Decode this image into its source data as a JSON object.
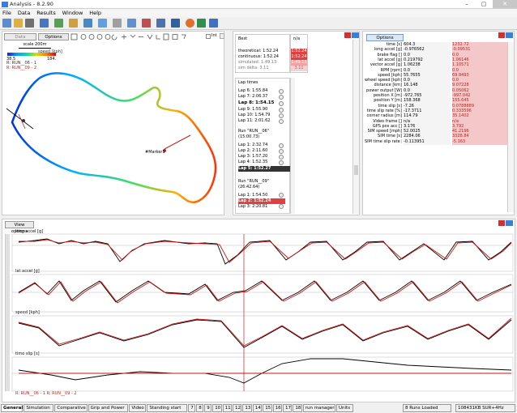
{
  "window": {
    "title": "Analysis - 8.2.90"
  },
  "menu": [
    "File",
    "Data",
    "Results",
    "Window",
    "Help"
  ],
  "map": {
    "tab_data": "Data",
    "tab_options": "Options",
    "scale": "scale 200m",
    "speed_label": "speed [kph]",
    "speed_min": "38.5",
    "speed_max": "184.",
    "run1": "R: RUN__06 - 1",
    "run2": "R: RUN__09 - 2",
    "marker": "#Marker1",
    "lap_short": "Int"
  },
  "best": {
    "header": "Best",
    "col2": "n/a",
    "rows": [
      [
        "theoretical: 1:52.24",
        "1:52.24"
      ],
      [
        "continuous: 1:52.24",
        "1:52.24"
      ],
      [
        "simulated: 1:49.13",
        "1:49.13"
      ],
      [
        "sim delta: 3.11",
        "3.11"
      ]
    ]
  },
  "laps": {
    "header": "Lap times",
    "items": [
      "Lap 6: 1:55.84",
      "Lap 7: 2:06.37",
      "Lap 8: 1:54.15",
      "Lap 9: 1:55.90",
      "Lap 10: 1:54.79",
      "Lap 11: 2:01.62",
      "",
      "Run \"RUN__06\"",
      "(15:00.73)",
      "Lap 1: 2:32.74",
      "Lap 2: 2:11.60",
      "Lap 3: 1:57.20",
      "Lap 4: 1:52.35",
      "Lap 5: 1:52.27",
      "",
      "Run \"RUN__09\"",
      "(26:42.64)",
      "Lap 1: 1:54.50",
      "Lap 2: 1:52.24",
      "Lap 3: 2:20.81"
    ]
  },
  "channels": {
    "options": "Options",
    "rows": [
      [
        "time [s]",
        "604.3",
        "1232.72"
      ],
      [
        "long accel [g]",
        "-0.976562",
        "-0.09531"
      ],
      [
        "brake flag []",
        "0.0",
        "0.0"
      ],
      [
        "lat accel [g]",
        "0.219792",
        "1.06146"
      ],
      [
        "vector accel [g]",
        "1.06238",
        "1.10571"
      ],
      [
        "RPM [rpm]",
        "0.0",
        "0.0"
      ],
      [
        "speed [kph]",
        "55.7655",
        "69.9493"
      ],
      [
        "wheel speed [kph]",
        "0.0",
        "0.0"
      ],
      [
        "distance [km]",
        "16.148",
        "9.07228"
      ],
      [
        "power output [W]",
        "0.0",
        "0.05062"
      ],
      [
        "position X [m]",
        "-972.765",
        "-997.042"
      ],
      [
        "position Y [m]",
        "158.368",
        "155.645"
      ],
      [
        "time slip [s]",
        "-7.26",
        "0.0788889"
      ],
      [
        "time slip rate [%]",
        "-17.3711",
        "0.333596"
      ],
      [
        "corner radius [m]",
        "114.79",
        "35.1402"
      ],
      [
        "Video frame []",
        "n/a",
        "n/a"
      ],
      [
        "GPS pos acc []",
        "3.176",
        "3.792"
      ],
      [
        "SIM speed [mph]",
        "52.0025",
        "41.2196"
      ],
      [
        "SIM time [s]",
        "2284.06",
        "3328.84"
      ],
      [
        "SIM time slip rate [%]",
        "-0.113951",
        "-5.163"
      ]
    ]
  },
  "graphs": {
    "view_options": "View options",
    "labels": [
      "long accel [g]",
      "lat accel [g]",
      "speed [kph]",
      "time slip [s]"
    ],
    "legend": "R: RUN__06 - 1  R: RUN__09 - 2"
  },
  "bottom_tabs": [
    "General",
    "Simulation",
    "Comparative",
    "Grip and Power",
    "Video",
    "Standing start",
    "7",
    "8",
    "9",
    "10",
    "11",
    "12",
    "13",
    "14",
    "15",
    "16",
    "17",
    "18",
    "run manager",
    "Units"
  ],
  "status": {
    "runs": "8 Runs Loaded",
    "mem": "108431KB SUR+4Hz"
  },
  "colors": {
    "accent": "#3a7fd5",
    "highlight": "#e03030",
    "trace_black": "#000000",
    "trace_red": "#cc1111"
  }
}
